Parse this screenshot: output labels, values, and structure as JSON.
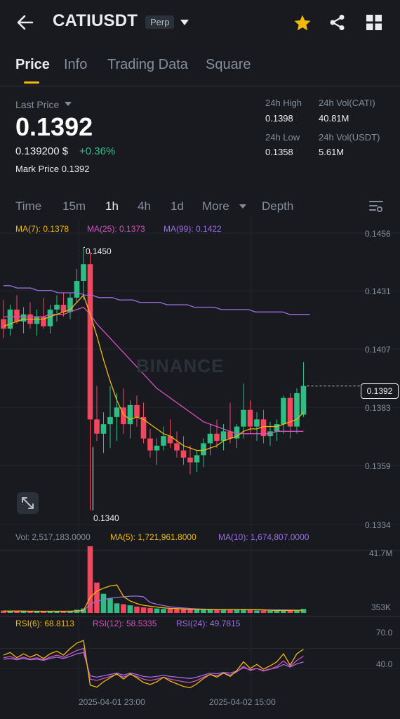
{
  "header": {
    "symbol": "CATIUSDT",
    "badge": "Perp",
    "icons": [
      "back-arrow-icon",
      "caret-down-icon",
      "star-icon",
      "share-icon",
      "grid-icon"
    ],
    "star_color": "#f0b90b"
  },
  "tabs": [
    {
      "label": "Price",
      "active": true
    },
    {
      "label": "Info",
      "active": false
    },
    {
      "label": "Trading Data",
      "active": false
    },
    {
      "label": "Square",
      "active": false
    }
  ],
  "price": {
    "last_price_label": "Last Price",
    "last_price": "0.1392",
    "usd_value": "0.139200 $",
    "change": "+0.36%",
    "mark_price": "Mark Price  0.1392"
  },
  "stats": {
    "high_label": "24h High",
    "high_value": "0.1398",
    "low_label": "24h Low",
    "low_value": "0.1358",
    "vol_cati_label": "24h Vol(CATI)",
    "vol_cati_value": "40.81M",
    "vol_usdt_label": "24h Vol(USDT)",
    "vol_usdt_value": "5.61M"
  },
  "timeframes": [
    {
      "label": "Time",
      "active": false
    },
    {
      "label": "15m",
      "active": false
    },
    {
      "label": "1h",
      "active": true
    },
    {
      "label": "4h",
      "active": false
    },
    {
      "label": "1d",
      "active": false
    },
    {
      "label": "More",
      "active": false
    },
    {
      "label": "Depth",
      "active": false
    }
  ],
  "ma": {
    "ma7": "MA(7): 0.1378",
    "ma25": "MA(25): 0.1373",
    "ma99": "MA(99): 0.1422",
    "colors": {
      "ma7": "#f0b90b",
      "ma25": "#d94ec3",
      "ma99": "#9b6fe0"
    }
  },
  "price_axis": [
    "0.1456",
    "0.1431",
    "0.1407",
    "0.1383",
    "0.1359",
    "0.1334"
  ],
  "current_price_tag": "0.1392",
  "annotations": {
    "high": "0.1450",
    "low": "0.1340"
  },
  "watermark": "BINANCE",
  "volume": {
    "vol": "Vol: 2,517,183.0000",
    "ma5": "MA(5): 1,721,961.8000",
    "ma10": "MA(10): 1,674,807.0000",
    "axis": [
      "41.7M",
      "353K"
    ]
  },
  "rsi": {
    "rsi6": "RSI(6): 68.8113",
    "rsi12": "RSI(12): 58.5335",
    "rsi24": "RSI(24): 49.7815",
    "axis": [
      "70.0",
      "40.0"
    ]
  },
  "time_axis": [
    "2025-04-01 23:00",
    "2025-04-02 15:00"
  ],
  "colors": {
    "up": "#2ebd85",
    "down": "#f6465d",
    "accent": "#f0b90b",
    "background": "#181a20"
  },
  "chart_data": {
    "type": "candlestick",
    "interval": "1h",
    "ylim": [
      0.1334,
      0.1456
    ],
    "candles": [
      {
        "o": 0.142,
        "h": 0.1428,
        "l": 0.1412,
        "c": 0.1416
      },
      {
        "o": 0.1416,
        "h": 0.1426,
        "l": 0.1413,
        "c": 0.1424
      },
      {
        "o": 0.1424,
        "h": 0.143,
        "l": 0.1418,
        "c": 0.1419
      },
      {
        "o": 0.1419,
        "h": 0.1425,
        "l": 0.1414,
        "c": 0.1422
      },
      {
        "o": 0.1422,
        "h": 0.1427,
        "l": 0.1416,
        "c": 0.1418
      },
      {
        "o": 0.1418,
        "h": 0.1424,
        "l": 0.1413,
        "c": 0.1421
      },
      {
        "o": 0.1421,
        "h": 0.1429,
        "l": 0.1416,
        "c": 0.1417
      },
      {
        "o": 0.1417,
        "h": 0.1426,
        "l": 0.1414,
        "c": 0.1424
      },
      {
        "o": 0.1424,
        "h": 0.143,
        "l": 0.1419,
        "c": 0.1426
      },
      {
        "o": 0.1426,
        "h": 0.1431,
        "l": 0.1421,
        "c": 0.1423
      },
      {
        "o": 0.1423,
        "h": 0.1431,
        "l": 0.142,
        "c": 0.1429
      },
      {
        "o": 0.1429,
        "h": 0.1441,
        "l": 0.1427,
        "c": 0.1436
      },
      {
        "o": 0.1436,
        "h": 0.145,
        "l": 0.1428,
        "c": 0.1443
      },
      {
        "o": 0.1443,
        "h": 0.1448,
        "l": 0.134,
        "c": 0.1378
      },
      {
        "o": 0.1378,
        "h": 0.1392,
        "l": 0.1369,
        "c": 0.1372
      },
      {
        "o": 0.1372,
        "h": 0.1381,
        "l": 0.1364,
        "c": 0.1376
      },
      {
        "o": 0.1376,
        "h": 0.1392,
        "l": 0.1366,
        "c": 0.1379
      },
      {
        "o": 0.1379,
        "h": 0.1389,
        "l": 0.1369,
        "c": 0.1383
      },
      {
        "o": 0.1383,
        "h": 0.1391,
        "l": 0.1372,
        "c": 0.1376
      },
      {
        "o": 0.1376,
        "h": 0.1386,
        "l": 0.137,
        "c": 0.1384
      },
      {
        "o": 0.1384,
        "h": 0.1388,
        "l": 0.1375,
        "c": 0.1379
      },
      {
        "o": 0.1379,
        "h": 0.1385,
        "l": 0.1368,
        "c": 0.137
      },
      {
        "o": 0.137,
        "h": 0.1374,
        "l": 0.1362,
        "c": 0.1365
      },
      {
        "o": 0.1365,
        "h": 0.137,
        "l": 0.1359,
        "c": 0.1367
      },
      {
        "o": 0.1367,
        "h": 0.1375,
        "l": 0.1365,
        "c": 0.1371
      },
      {
        "o": 0.1371,
        "h": 0.1378,
        "l": 0.1366,
        "c": 0.1368
      },
      {
        "o": 0.1368,
        "h": 0.1373,
        "l": 0.1362,
        "c": 0.1365
      },
      {
        "o": 0.1365,
        "h": 0.1371,
        "l": 0.1359,
        "c": 0.1362
      },
      {
        "o": 0.1362,
        "h": 0.1367,
        "l": 0.1355,
        "c": 0.136
      },
      {
        "o": 0.136,
        "h": 0.1365,
        "l": 0.1356,
        "c": 0.1363
      },
      {
        "o": 0.1363,
        "h": 0.137,
        "l": 0.1358,
        "c": 0.1368
      },
      {
        "o": 0.1368,
        "h": 0.1376,
        "l": 0.1363,
        "c": 0.1372
      },
      {
        "o": 0.1372,
        "h": 0.1378,
        "l": 0.1366,
        "c": 0.1369
      },
      {
        "o": 0.1369,
        "h": 0.1376,
        "l": 0.1365,
        "c": 0.1373
      },
      {
        "o": 0.1373,
        "h": 0.1385,
        "l": 0.1368,
        "c": 0.137
      },
      {
        "o": 0.137,
        "h": 0.1376,
        "l": 0.1366,
        "c": 0.1375
      },
      {
        "o": 0.1375,
        "h": 0.1393,
        "l": 0.137,
        "c": 0.1382
      },
      {
        "o": 0.1382,
        "h": 0.1386,
        "l": 0.1372,
        "c": 0.1375
      },
      {
        "o": 0.1375,
        "h": 0.1381,
        "l": 0.1369,
        "c": 0.1378
      },
      {
        "o": 0.1378,
        "h": 0.1382,
        "l": 0.1368,
        "c": 0.1371
      },
      {
        "o": 0.1371,
        "h": 0.1377,
        "l": 0.1367,
        "c": 0.1373
      },
      {
        "o": 0.1373,
        "h": 0.1378,
        "l": 0.1369,
        "c": 0.1376
      },
      {
        "o": 0.1376,
        "h": 0.1388,
        "l": 0.1372,
        "c": 0.1387
      },
      {
        "o": 0.1387,
        "h": 0.1389,
        "l": 0.137,
        "c": 0.1375
      },
      {
        "o": 0.1375,
        "h": 0.1391,
        "l": 0.1372,
        "c": 0.1389
      },
      {
        "o": 0.138,
        "h": 0.1402,
        "l": 0.1379,
        "c": 0.1392
      }
    ],
    "ma7": [
      0.1417,
      0.1418,
      0.1419,
      0.142,
      0.142,
      0.142,
      0.142,
      0.1421,
      0.1422,
      0.1423,
      0.1424,
      0.1427,
      0.143,
      0.1422,
      0.1413,
      0.1403,
      0.1394,
      0.1386,
      0.138,
      0.1378,
      0.1379,
      0.1378,
      0.1376,
      0.1374,
      0.1372,
      0.1371,
      0.1369,
      0.1367,
      0.1366,
      0.1365,
      0.1365,
      0.1366,
      0.1367,
      0.1369,
      0.137,
      0.1371,
      0.1373,
      0.1374,
      0.1374,
      0.1375,
      0.1375,
      0.1375,
      0.1376,
      0.1377,
      0.1378,
      0.1381
    ],
    "ma25": [
      0.1421,
      0.1421,
      0.1421,
      0.1421,
      0.1421,
      0.1421,
      0.1421,
      0.1422,
      0.1422,
      0.1422,
      0.1423,
      0.1424,
      0.1425,
      0.1422,
      0.1418,
      0.1415,
      0.1412,
      0.1409,
      0.1406,
      0.1403,
      0.14,
      0.1397,
      0.1394,
      0.1391,
      0.1389,
      0.1387,
      0.1385,
      0.1383,
      0.1381,
      0.1379,
      0.1377,
      0.1376,
      0.1375,
      0.1374,
      0.1373,
      0.1372,
      0.1372,
      0.1372,
      0.1372,
      0.1372,
      0.1372,
      0.1373,
      0.1373,
      0.1373,
      0.1373,
      0.1373
    ],
    "ma99": [
      0.1434,
      0.1434,
      0.1433,
      0.1433,
      0.1433,
      0.1432,
      0.1432,
      0.1432,
      0.1431,
      0.1431,
      0.1431,
      0.1431,
      0.143,
      0.143,
      0.1429,
      0.1429,
      0.1429,
      0.1428,
      0.1428,
      0.1428,
      0.1427,
      0.1427,
      0.1427,
      0.1427,
      0.1426,
      0.1426,
      0.1426,
      0.1426,
      0.1425,
      0.1425,
      0.1425,
      0.1425,
      0.1424,
      0.1424,
      0.1424,
      0.1424,
      0.1424,
      0.1423,
      0.1423,
      0.1423,
      0.1423,
      0.1423,
      0.1422,
      0.1422,
      0.1422,
      0.1422
    ],
    "volume": [
      1.5,
      1.2,
      1.0,
      1.1,
      0.9,
      1.0,
      1.2,
      1.0,
      1.1,
      1.0,
      1.3,
      2.0,
      2.8,
      41.7,
      19.0,
      12.0,
      9.0,
      6.0,
      5.5,
      4.8,
      4.0,
      3.5,
      3.2,
      2.8,
      2.5,
      2.6,
      2.4,
      2.2,
      2.0,
      2.1,
      2.3,
      2.0,
      1.8,
      1.9,
      2.4,
      1.8,
      2.5,
      1.9,
      1.6,
      1.5,
      1.4,
      1.5,
      2.2,
      1.6,
      2.0,
      2.517
    ],
    "vol_ma5": [
      1.2,
      1.2,
      1.2,
      1.2,
      1.1,
      1.1,
      1.0,
      1.1,
      1.1,
      1.1,
      1.1,
      1.3,
      1.6,
      9.8,
      13.6,
      15.5,
      16.9,
      17.5,
      10.3,
      7.5,
      5.9,
      4.8,
      4.2,
      3.7,
      3.2,
      2.9,
      2.7,
      2.5,
      2.3,
      2.3,
      2.3,
      2.1,
      2.0,
      2.1,
      2.1,
      2.0,
      2.1,
      2.1,
      2.0,
      1.9,
      1.7,
      1.6,
      1.6,
      1.6,
      1.7,
      1.72
    ],
    "vol_ma10": [
      1.2,
      1.2,
      1.2,
      1.1,
      1.1,
      1.1,
      1.1,
      1.1,
      1.1,
      1.1,
      1.1,
      1.2,
      1.4,
      5.5,
      7.3,
      8.4,
      9.2,
      9.7,
      10.1,
      10.5,
      10.6,
      10.1,
      6.6,
      5.5,
      4.6,
      3.9,
      3.4,
      3.1,
      2.8,
      2.6,
      2.4,
      2.3,
      2.2,
      2.1,
      2.1,
      2.1,
      2.1,
      2.1,
      2.0,
      2.0,
      1.9,
      1.9,
      1.9,
      1.8,
      1.7,
      1.67
    ],
    "rsi6": [
      60,
      64,
      56,
      62,
      57,
      61,
      55,
      62,
      66,
      60,
      70,
      78,
      82,
      15,
      12,
      20,
      26,
      32,
      24,
      32,
      26,
      19,
      16,
      20,
      27,
      21,
      17,
      13,
      11,
      17,
      25,
      31,
      27,
      33,
      28,
      37,
      50,
      40,
      46,
      39,
      44,
      50,
      62,
      45,
      62,
      68.81
    ],
    "rsi12": [
      56,
      58,
      54,
      57,
      54,
      56,
      53,
      57,
      60,
      57,
      62,
      67,
      70,
      24,
      22,
      25,
      28,
      31,
      27,
      31,
      28,
      24,
      22,
      24,
      27,
      24,
      22,
      20,
      19,
      22,
      27,
      31,
      29,
      33,
      30,
      35,
      43,
      37,
      40,
      36,
      39,
      43,
      51,
      43,
      52,
      58.53
    ],
    "rsi24": [
      54,
      55,
      53,
      55,
      53,
      54,
      52,
      55,
      57,
      55,
      58,
      62,
      64,
      29,
      27,
      29,
      31,
      33,
      30,
      33,
      31,
      28,
      27,
      28,
      30,
      28,
      27,
      26,
      25,
      27,
      30,
      33,
      32,
      34,
      33,
      36,
      41,
      38,
      40,
      37,
      39,
      41,
      46,
      42,
      47,
      49.78
    ]
  }
}
